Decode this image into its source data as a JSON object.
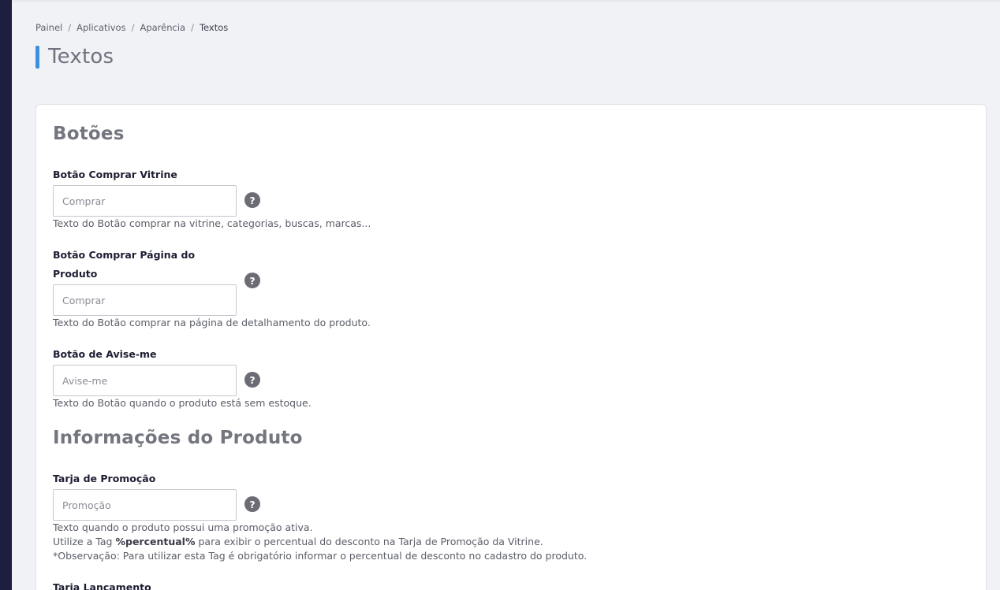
{
  "breadcrumb": {
    "items": [
      "Painel",
      "Aplicativos",
      "Aparência"
    ],
    "current": "Textos"
  },
  "page": {
    "title": "Textos"
  },
  "sections": {
    "botoes": {
      "title": "Botões",
      "fields": [
        {
          "label": "Botão Comprar Vitrine",
          "placeholder": "Comprar",
          "help": "Texto do Botão comprar na vitrine, categorias, buscas, marcas..."
        },
        {
          "label_line1": "Botão Comprar Página do",
          "label_line2": "Produto",
          "placeholder": "Comprar",
          "help": "Texto do Botão comprar na página de detalhamento do produto."
        },
        {
          "label": "Botão de Avise-me",
          "placeholder": "Avise-me",
          "help": "Texto do Botão quando o produto está sem estoque."
        }
      ]
    },
    "produto": {
      "title": "Informações do Produto",
      "fields": [
        {
          "label": "Tarja de Promoção",
          "placeholder": "Promoção",
          "help_line1": "Texto quando o produto possui uma promoção ativa.",
          "help_line2_pre": "Utilize a Tag ",
          "help_line2_tag": "%percentual%",
          "help_line2_post": " para exibir o percentual do desconto na Tarja de Promoção da Vitrine.",
          "help_line3": "*Observação: Para utilizar esta Tag é obrigatório informar o percentual de desconto no cadastro do produto."
        },
        {
          "label": "Tarja Lançamento"
        }
      ]
    }
  },
  "help_icon_glyph": "?",
  "colors": {
    "sidebar": "#1e1e3f",
    "accent": "#3d8fe0",
    "background": "#f1f2f6"
  }
}
